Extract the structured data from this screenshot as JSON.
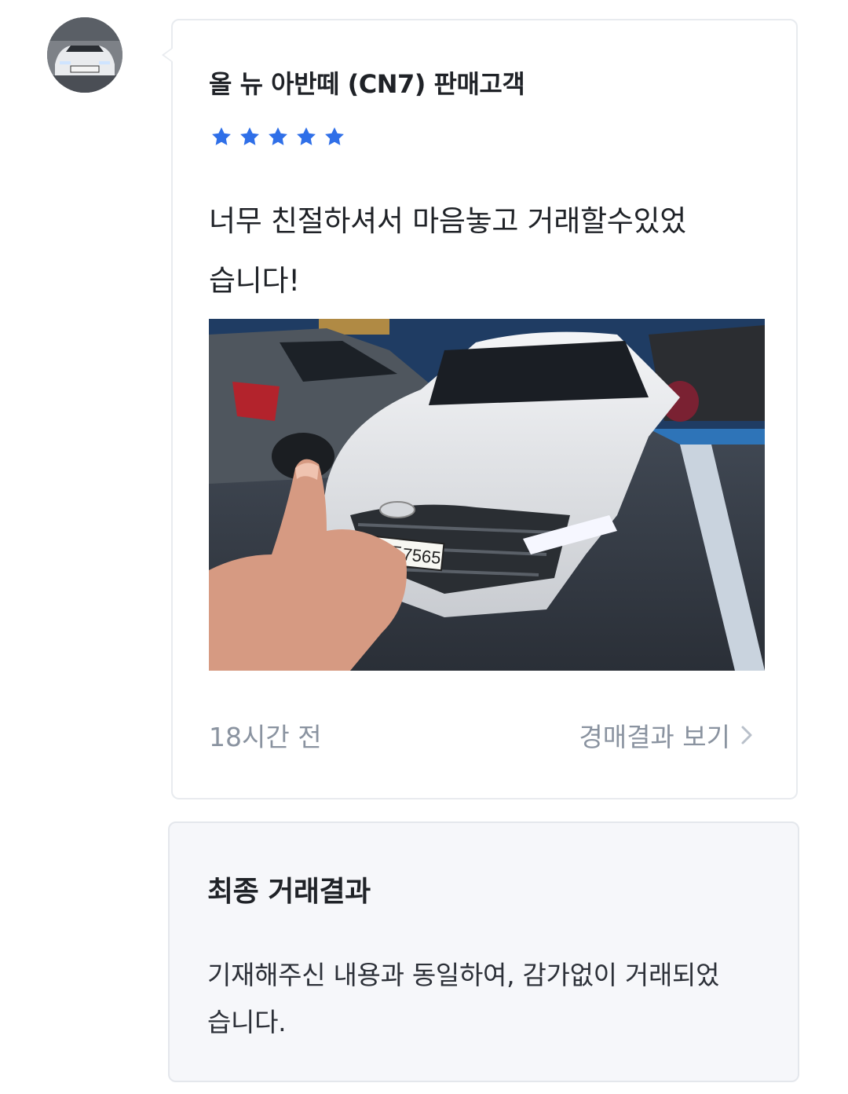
{
  "review": {
    "title": "올 뉴 아반떼 (CN7) 판매고객",
    "rating": 5,
    "rating_max": 5,
    "star_color": "#2f6fe8",
    "text_line1": "너무 친절하셔서 마음놓고 거래할수있었",
    "text_line2": "습니다!",
    "photo_plate": "284조7565",
    "time_ago": "18시간 전",
    "auction_link_label": "경매결과 보기"
  },
  "result": {
    "title": "최종 거래결과",
    "text_line1": "기재해주신 내용과 동일하여, 감가없이 거래되었",
    "text_line2": "습니다."
  },
  "icons": {
    "star": "star-icon",
    "chevron": "chevron-right-icon"
  }
}
